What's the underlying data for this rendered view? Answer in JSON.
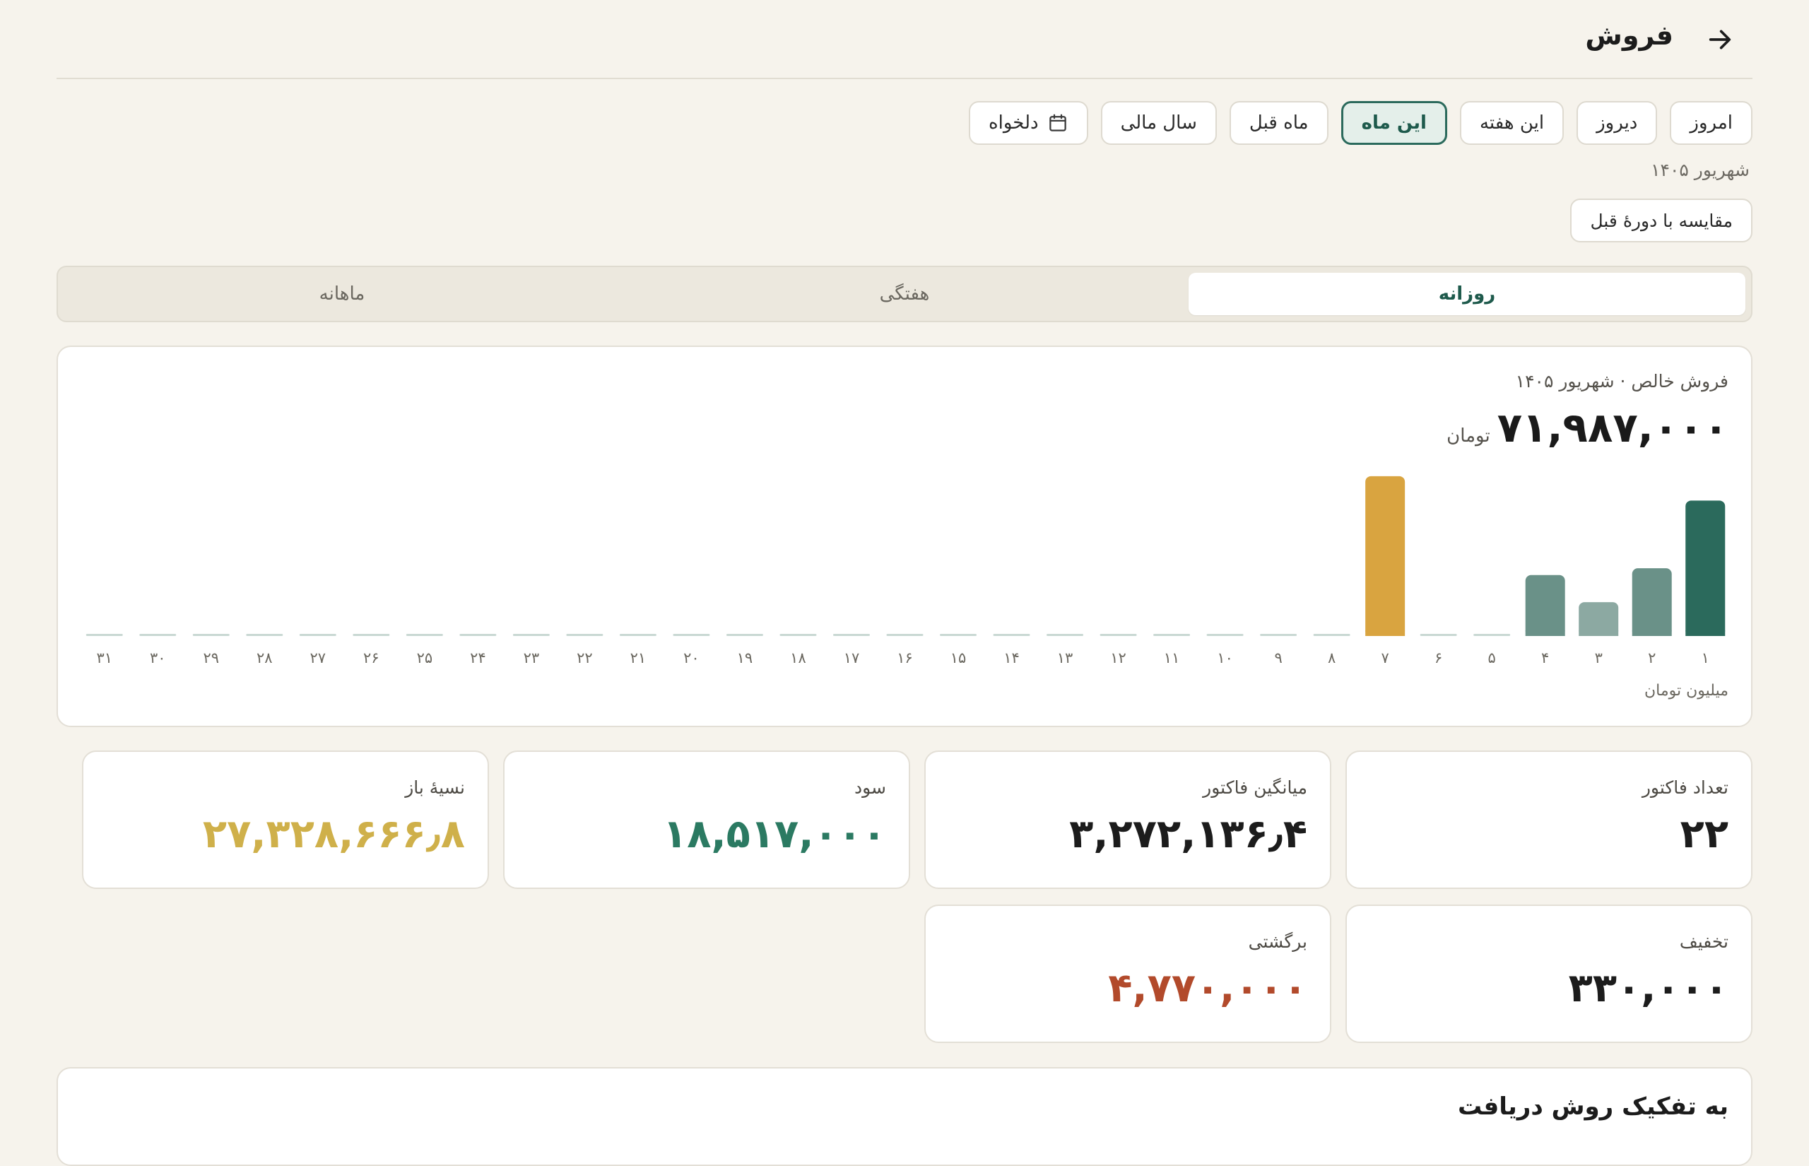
{
  "header": {
    "title": "فروش",
    "back_icon": "arrow-right-icon"
  },
  "periods": [
    {
      "label": "امروز",
      "active": false
    },
    {
      "label": "دیروز",
      "active": false
    },
    {
      "label": "این هفته",
      "active": false
    },
    {
      "label": "این ماه",
      "active": true
    },
    {
      "label": "ماه قبل",
      "active": false
    },
    {
      "label": "سال مالی",
      "active": false
    },
    {
      "label": "دلخواه",
      "active": false,
      "icon": "calendar-icon"
    }
  ],
  "date_label": "شهریور ۱۴۰۵",
  "compare_label": "مقایسه با دورهٔ قبل",
  "segments": [
    {
      "label": "روزانه",
      "active": true
    },
    {
      "label": "هفتگی",
      "active": false
    },
    {
      "label": "ماهانه",
      "active": false
    }
  ],
  "chart_card": {
    "subtitle": "فروش خالص · شهریور ۱۴۰۵",
    "total": "۷۱,۹۸۷,۰۰۰",
    "total_unit": "تومان",
    "unit_label": "میلیون تومان"
  },
  "chart_data": {
    "type": "bar",
    "categories": [
      "۱",
      "۲",
      "۳",
      "۴",
      "۵",
      "۶",
      "۷",
      "۸",
      "۹",
      "۱۰",
      "۱۱",
      "۱۲",
      "۱۳",
      "۱۴",
      "۱۵",
      "۱۶",
      "۱۷",
      "۱۸",
      "۱۹",
      "۲۰",
      "۲۱",
      "۲۲",
      "۲۳",
      "۲۴",
      "۲۵",
      "۲۶",
      "۲۷",
      "۲۸",
      "۲۹",
      "۳۰",
      "۳۱"
    ],
    "values": [
      20.0,
      10.0,
      5.0,
      9.0,
      0,
      0,
      23.6,
      0,
      0,
      0,
      0,
      0,
      0,
      0,
      0,
      0,
      0,
      0,
      0,
      0,
      0,
      0,
      0,
      0,
      0,
      0,
      0,
      0,
      0,
      0,
      0
    ],
    "ylim": [
      0,
      24
    ],
    "direction": "rtl",
    "colors": {
      "max": "#d9a440",
      "latest": "#2b6a5c",
      "normal": "#6a9188",
      "light": "#8ca9a2",
      "empty": "#c9d8d3"
    },
    "ylabel": "میلیون تومان"
  },
  "stats": [
    {
      "label": "تعداد فاکتور",
      "value": "۲۲",
      "color": "#1c1c1c"
    },
    {
      "label": "میانگین فاکتور",
      "value": "۳,۲۷۲,۱۳۶٫۴",
      "color": "#1c1c1c"
    },
    {
      "label": "سود",
      "value": "۱۸,۵۱۷,۰۰۰",
      "color": "#2b7a62"
    },
    {
      "label": "نسیهٔ باز",
      "value": "۲۷,۳۲۸,۶۶۶٫۸",
      "color": "#cfb04a"
    },
    {
      "label": "تخفیف",
      "value": "۳۳۰,۰۰۰",
      "color": "#1c1c1c"
    },
    {
      "label": "برگشتی",
      "value": "۴,۷۷۰,۰۰۰",
      "color": "#b24a2b"
    }
  ],
  "breakdown": {
    "title": "به تفکیک روش دریافت"
  }
}
